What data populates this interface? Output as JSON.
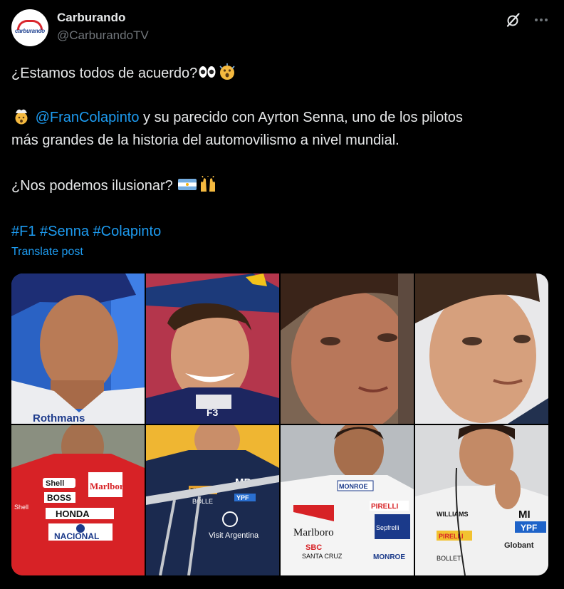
{
  "author": {
    "name": "Carburando",
    "handle": "@CarburandoTV",
    "avatar_logo_text": "carburando"
  },
  "post": {
    "line1": "¿Estamos todos de acuerdo?",
    "line2_mention": "@FranColapinto",
    "line2_rest": " y su parecido con Ayrton Senna, uno de los pilotos",
    "line3": "más grandes de la historia del automovilismo a nivel mundial.",
    "line4": "¿Nos podemos ilusionar?",
    "hashtags": [
      "#F1",
      "#Senna",
      "#Colapinto"
    ],
    "translate_label": "Translate post"
  },
  "images": {
    "t1": {
      "text": "Rothmans"
    },
    "t2": {
      "text": "F3"
    },
    "t5": {
      "shell": "Shell",
      "boss": "BOSS",
      "marlboro": "Marlboro",
      "honda": "HONDA",
      "nacional": "NACIONAL",
      "side": "Shell"
    },
    "t6": {
      "pirelli": "PIRELLI",
      "mp": "MP",
      "ypf": "YPF",
      "visit": "Visit Argentina",
      "bollet": "BOLLE"
    },
    "t7": {
      "monroe": "MONROE",
      "pirelli": "PIRELLI",
      "marlboro": "Marlboro",
      "sep": "Sepfrelli",
      "sbc": "SBC",
      "santa": "SANTA CRUZ",
      "monroe2": "MONROE"
    },
    "t8": {
      "williams": "WILLIAMS",
      "mt": "MI",
      "ypf": "YPF",
      "pirelli": "PIRELLI",
      "globant": "Globant",
      "bollet": "BOLLET"
    }
  },
  "colors": {
    "accent": "#1d9bf0",
    "text": "#e7e9ea",
    "muted": "#71767b",
    "background": "#000000"
  }
}
